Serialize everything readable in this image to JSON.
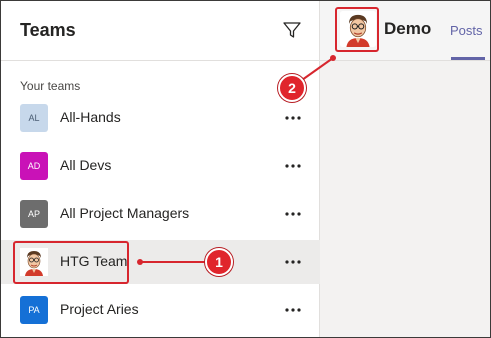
{
  "sidebar": {
    "title": "Teams",
    "section_label": "Your teams",
    "teams": [
      {
        "initials": "AL",
        "name": "All-Hands",
        "avatar_bg": "#c7d8eb",
        "avatar_fg": "#4a5d74"
      },
      {
        "initials": "AD",
        "name": "All Devs",
        "avatar_bg": "#c912b7",
        "avatar_fg": "#ffffff"
      },
      {
        "initials": "AP",
        "name": "All Project Managers",
        "avatar_bg": "#6d6d6d",
        "avatar_fg": "#ffffff"
      },
      {
        "initials": "",
        "name": "HTG Team",
        "avatar": "cartoon-man-icon",
        "selected": true
      },
      {
        "initials": "PA",
        "name": "Project Aries",
        "avatar_bg": "#1570d6",
        "avatar_fg": "#ffffff"
      }
    ]
  },
  "channel": {
    "name": "Demo",
    "tab": "Posts",
    "avatar": "cartoon-man-icon"
  },
  "annotations": [
    {
      "number": "1",
      "color": "#d7262e"
    },
    {
      "number": "2",
      "color": "#d7262e"
    }
  ],
  "icons": {
    "filter": "filter-icon",
    "more": "more-options-icon"
  },
  "colors": {
    "accent": "#6264a7",
    "selected_row": "#ecebea",
    "annotation": "#d7262e"
  }
}
